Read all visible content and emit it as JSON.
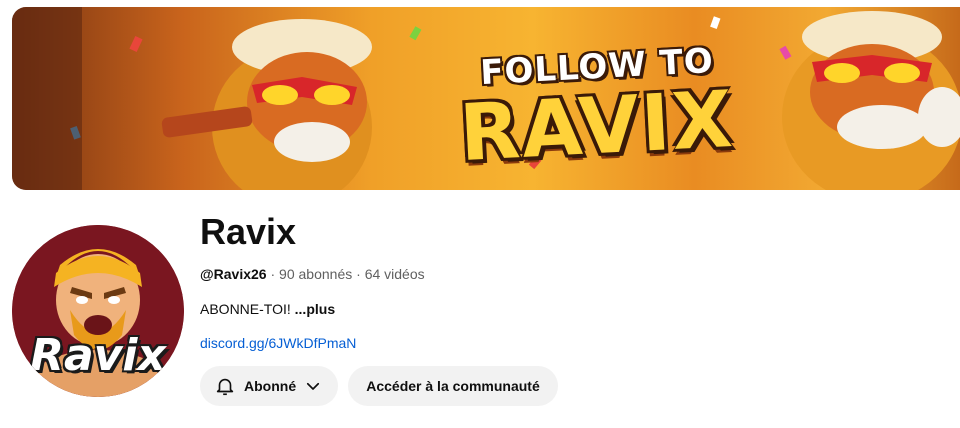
{
  "banner": {
    "line1": "FOLLOW TO",
    "line2": "RAVIX"
  },
  "avatar": {
    "word": "Ravix"
  },
  "channel": {
    "name": "Ravix",
    "handle": "@Ravix26",
    "separator": " · ",
    "subscribers": "90 abonnés",
    "videos": "64 vidéos",
    "description": "ABONNE-TOI!",
    "more_label": "...plus",
    "link": "discord.gg/6JWkDfPmaN"
  },
  "actions": {
    "subscribed_label": "Abonné",
    "community_label": "Accéder à la communauté"
  },
  "icons": {
    "bell": "bell-icon",
    "chevron": "chevron-down-icon"
  },
  "colors": {
    "link": "#065fd4",
    "button_bg": "#f2f2f2",
    "banner_accent": "#f7b431",
    "avatar_bg": "#7a1620"
  }
}
